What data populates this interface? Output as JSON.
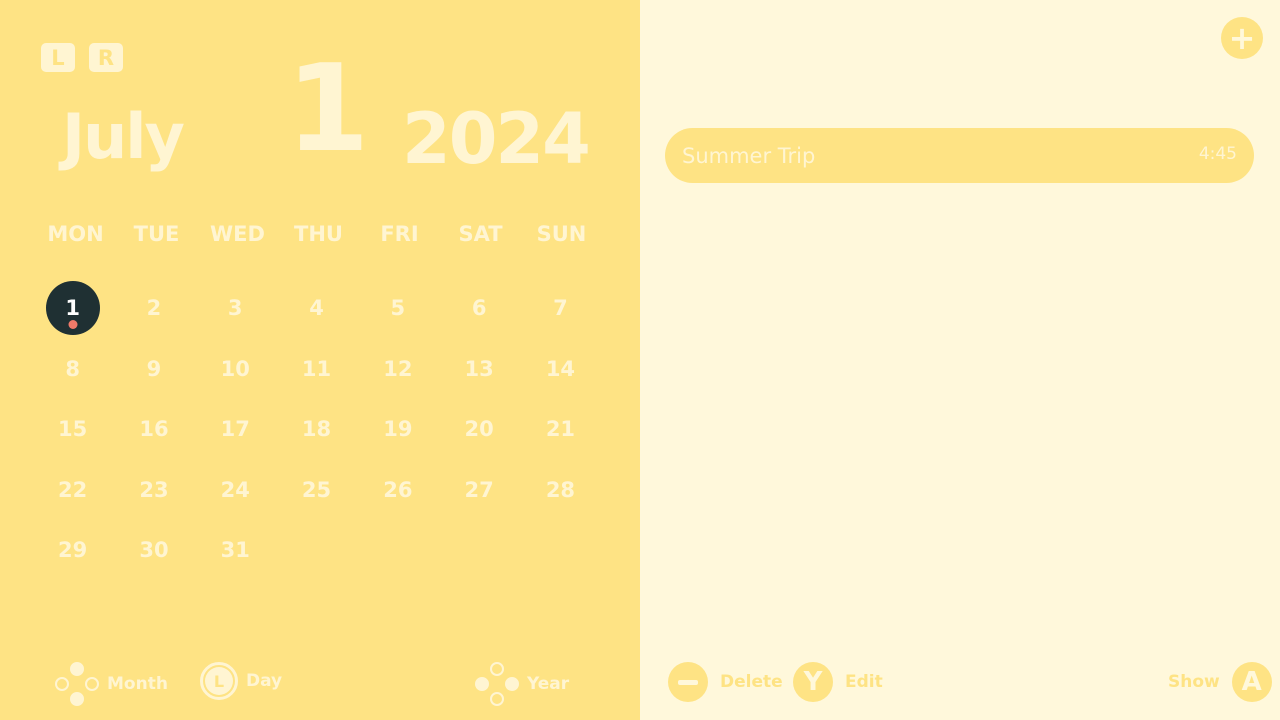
{
  "header": {
    "shoulder_left": "L",
    "shoulder_right": "R",
    "month": "July",
    "day": "1",
    "year": "2024"
  },
  "weekdays": [
    "MON",
    "TUE",
    "WED",
    "THU",
    "FRI",
    "SAT",
    "SUN"
  ],
  "calendar": {
    "selected_day": "1",
    "days": [
      "1",
      "2",
      "3",
      "4",
      "5",
      "6",
      "7",
      "8",
      "9",
      "10",
      "11",
      "12",
      "13",
      "14",
      "15",
      "16",
      "17",
      "18",
      "19",
      "20",
      "21",
      "22",
      "23",
      "24",
      "25",
      "26",
      "27",
      "28",
      "29",
      "30",
      "31"
    ]
  },
  "left_hints": {
    "month_label": "Month",
    "day_label": "Day",
    "day_stick_letter": "L",
    "year_label": "Year"
  },
  "events": [
    {
      "title": "Summer Trip",
      "time": "4:45"
    }
  ],
  "right_hints": {
    "add_symbol": "+",
    "delete_label": "Delete",
    "edit_button": "Y",
    "edit_label": "Edit",
    "show_label": "Show",
    "show_button": "A"
  },
  "colors": {
    "left_bg": "#fee384",
    "right_bg": "#fff8db",
    "text_light": "#fff5d2",
    "selected_circle": "#1f3033",
    "event_dot": "#f07a6a"
  }
}
